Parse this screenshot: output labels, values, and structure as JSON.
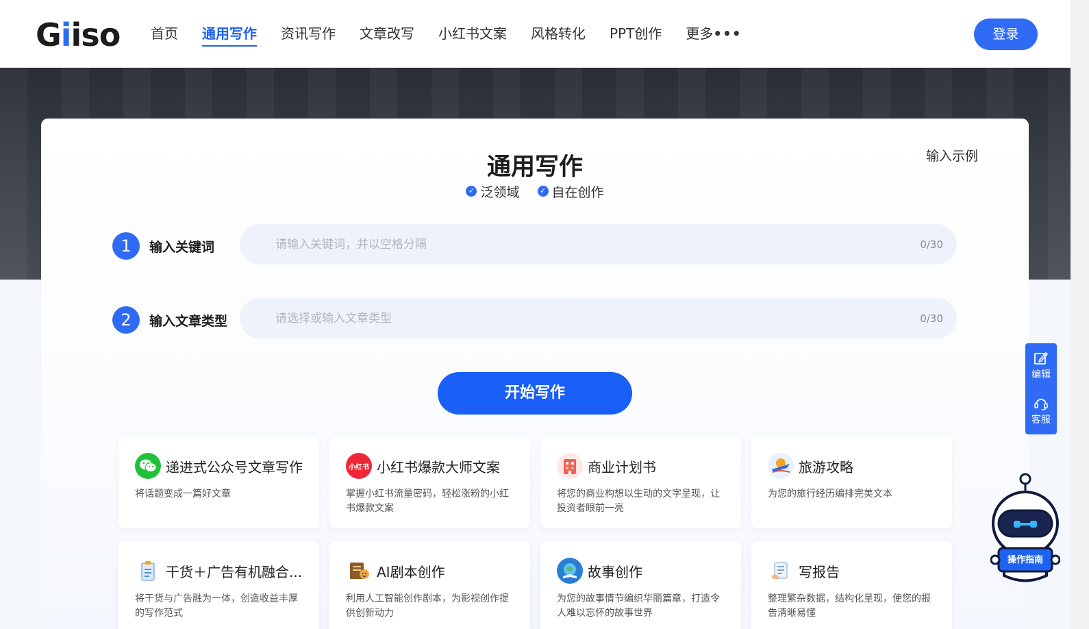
{
  "header": {
    "logo": "Giiso",
    "nav": [
      "首页",
      "通用写作",
      "资讯写作",
      "文章改写",
      "小红书文案",
      "风格转化",
      "PPT创作",
      "更多"
    ],
    "more_dots": "•••",
    "login": "登录"
  },
  "main": {
    "title": "通用写作",
    "tags": [
      "泛领域",
      "自在创作"
    ],
    "example_link": "输入示例",
    "step1": {
      "num": "1",
      "label": "输入关键词",
      "placeholder": "请输入关键词，并以空格分隔",
      "counter": "0/30"
    },
    "step2": {
      "num": "2",
      "label": "输入文章类型",
      "placeholder": "请选择或输入文章类型",
      "counter": "0/30"
    },
    "start_button": "开始写作"
  },
  "templates": [
    {
      "title": "递进式公众号文章写作",
      "desc": "将话题变成一篇好文章",
      "icon": "wechat-icon",
      "color": "#1ec23a"
    },
    {
      "title": "小红书爆款大师文案",
      "desc": "掌握小红书流量密码，轻松涨粉的小红书爆款文案",
      "icon": "xiaohongshu-icon",
      "icon_text": "小红书",
      "color": "#ee2737"
    },
    {
      "title": "商业计划书",
      "desc": "将您的商业构想以生动的文字呈现，让投资者眼前一亮",
      "icon": "building-icon",
      "color": "#f25f5c"
    },
    {
      "title": "旅游攻略",
      "desc": "为您的旅行经历编排完美文本",
      "icon": "airplane-icon",
      "color": "#f5a623"
    },
    {
      "title": "干货＋广告有机融合...",
      "desc": "将干货与广告融为一体，创造收益丰厚的写作范式",
      "icon": "clipboard-icon",
      "color": "#4a90e2"
    },
    {
      "title": "AI剧本创作",
      "desc": "利用人工智能创作剧本，为影视创作提供创新动力",
      "icon": "script-icon",
      "color": "#8b5a2b"
    },
    {
      "title": "故事创作",
      "desc": "为您的故事情节编织华丽篇章，打造令人难以忘怀的故事世界",
      "icon": "globe-book-icon",
      "color": "#2a7fd4"
    },
    {
      "title": "写报告",
      "desc": "整理繁杂数据，结构化呈现，使您的报告清晰易懂",
      "icon": "report-icon",
      "color": "#7fa7c9"
    }
  ],
  "float_panel": {
    "edit": "编辑",
    "service": "客服"
  },
  "robot": {
    "label": "操作指南"
  },
  "colors": {
    "accent": "#2f6bf5",
    "primary_button": "#1a5ff6"
  }
}
